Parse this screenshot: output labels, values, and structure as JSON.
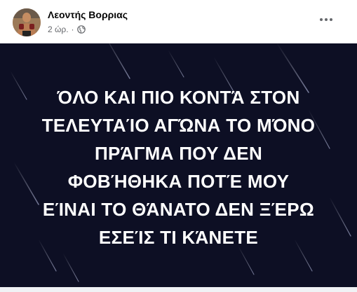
{
  "post": {
    "author": "Λεοντής Βορριας",
    "time": "2 ώρ.",
    "separator": "·",
    "privacy_icon": "globe-icon",
    "more_icon": "more-options-icon",
    "image_text_lines": [
      "ΌΛΟ ΚΑΙ ΠΙΟ ΚΟΝΤΆ ΣΤΟΝ",
      "ΤΕΛΕΥΤΑΊΟ ΑΓΏΝΑ ΤΟ ΜΌΝΟ",
      "ΠΡΆΓΜΑ ΠΟΥ ΔΕΝ",
      "ΦΟΒΉΘΗΚΑ ΠΟΤΈ ΜΟΥ",
      "ΕΊΝΑΙ ΤΟ ΘΆΝΑΤΟ ΔΕΝ ΞΈΡΩ",
      "ΕΣΕΊΣ ΤΙ ΚΆΝΕΤΕ"
    ]
  },
  "colors": {
    "image_background": "#0d0f24",
    "image_text": "#ffffff",
    "meta_text": "#65676b",
    "name_text": "#050505"
  }
}
